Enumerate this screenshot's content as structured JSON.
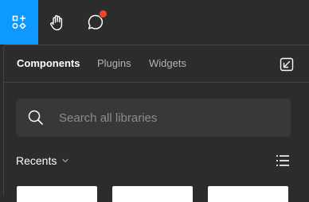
{
  "toolbar": {
    "tools": [
      {
        "name": "resources",
        "icon": "resources-icon",
        "active": true
      },
      {
        "name": "hand",
        "icon": "hand-icon",
        "active": false
      },
      {
        "name": "comment",
        "icon": "comment-icon",
        "active": false,
        "has_notification": true
      }
    ],
    "accent_color": "#0d99ff",
    "notification_color": "#f24822"
  },
  "panel": {
    "tabs": [
      {
        "label": "Components",
        "selected": true
      },
      {
        "label": "Plugins",
        "selected": false
      },
      {
        "label": "Widgets",
        "selected": false
      }
    ],
    "expand_icon": "open-in-window-icon",
    "search": {
      "placeholder": "Search all libraries",
      "value": ""
    },
    "section": {
      "label": "Recents",
      "view_icon": "list-view-icon"
    },
    "cards_count": 3
  }
}
